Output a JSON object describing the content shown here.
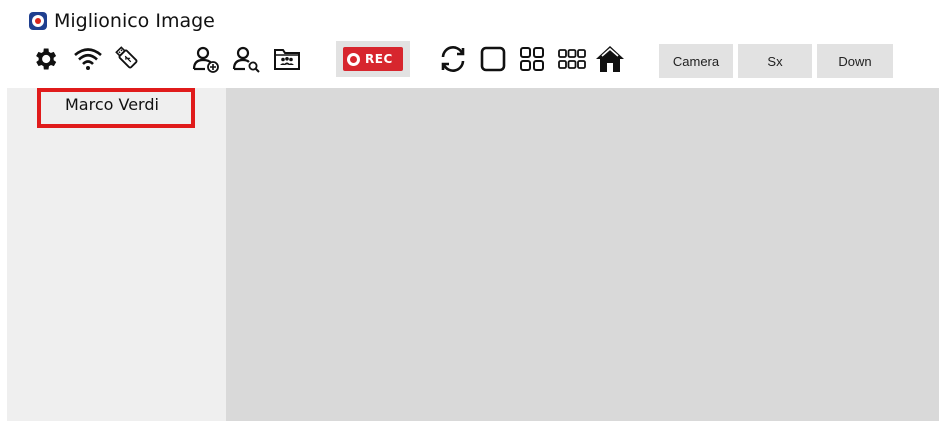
{
  "app": {
    "title": "Miglionico Image",
    "icon": "app-logo-icon"
  },
  "toolbar": {
    "icons": [
      "gear-icon",
      "wifi-icon",
      "usb-drive-icon",
      "add-user-icon",
      "search-user-icon",
      "group-folder-icon",
      "record-icon",
      "refresh-icon",
      "single-view-icon",
      "grid-2x2-icon",
      "grid-2x3-icon",
      "home-icon"
    ],
    "rec_label": "REC",
    "buttons": {
      "camera": "Camera",
      "sx": "Sx",
      "down": "Down"
    }
  },
  "sidebar": {
    "users": [
      {
        "name": "Marco Verdi"
      }
    ]
  },
  "colors": {
    "accent": "#d7262e",
    "highlight_border": "#e01b1b",
    "sidebar_bg": "#efefef",
    "main_bg": "#d9d9d9"
  }
}
